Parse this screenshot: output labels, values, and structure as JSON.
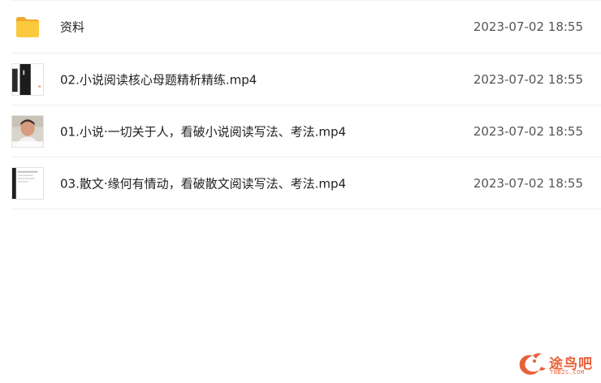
{
  "files": [
    {
      "name": "资料",
      "date": "2023-07-02 18:55",
      "icon": "folder-icon"
    },
    {
      "name": "02.小说阅读核心母题精析精练.mp4",
      "date": "2023-07-02 18:55",
      "icon": "video-thumbnail"
    },
    {
      "name": "01.小说·一切关于人，看破小说阅读写法、考法.mp4",
      "date": "2023-07-02 18:55",
      "icon": "video-thumbnail"
    },
    {
      "name": "03.散文·缘何有情动，看破散文阅读写法、考法.mp4",
      "date": "2023-07-02 18:55",
      "icon": "video-thumbnail"
    }
  ],
  "watermark": {
    "text": "途鸟吧",
    "sub": "TNBZS.COM"
  },
  "colors": {
    "folder": "#f7c33c",
    "watermark": "#e8613a",
    "divider": "#eeeff2"
  }
}
